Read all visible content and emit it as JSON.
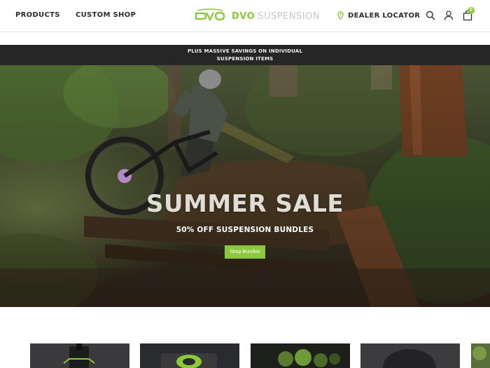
{
  "header": {
    "nav": [
      {
        "label": "PRODUCTS"
      },
      {
        "label": "CUSTOM SHOP"
      }
    ],
    "logo": {
      "brand": "DVO",
      "suffix": "SUSPENSION"
    },
    "dealer_locator": "DEALER LOCATOR",
    "cart_count": "0",
    "icons": [
      "search-icon",
      "account-icon",
      "cart-icon",
      "location-pin-icon"
    ]
  },
  "promo": {
    "line1": "PLUS MASSIVE SAVINGS ON INDIVIDUAL",
    "line2": "SUSPENSION ITEMS"
  },
  "hero": {
    "title": "SUMMER SALE",
    "subtitle": "50% OFF SUSPENSION BUNDLES",
    "button": "Shop Bundles"
  },
  "colors": {
    "accent": "#8cc83c",
    "promo_bg": "#262626",
    "text_dark": "#2b2b2b"
  }
}
